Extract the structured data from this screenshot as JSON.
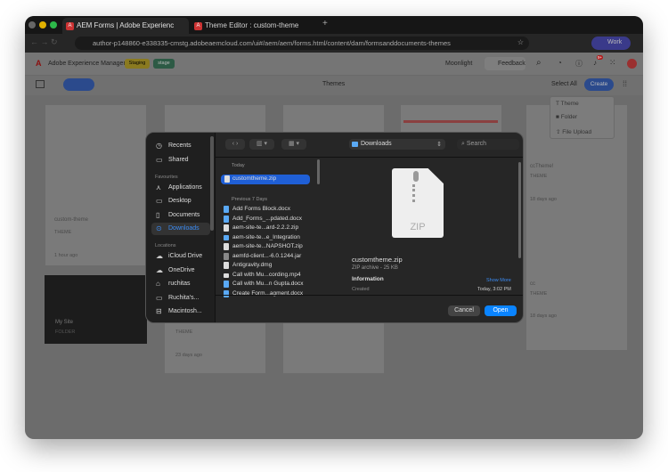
{
  "browser": {
    "tabs": [
      {
        "label": "AEM Forms | Adobe Experienc"
      },
      {
        "label": "Theme Editor : custom-theme"
      }
    ],
    "url": "author-p148860-e338335-cmstg.adobeaemcloud.com/ui#/aem/aem/forms.html/content/dam/formsanddocuments-themes",
    "profile": "Work"
  },
  "aem": {
    "product": "Adobe Experience Manager",
    "badges": [
      "Staging",
      "stage"
    ],
    "org": "Moonlight",
    "feedback": "Feedback",
    "notifications": "9+",
    "page_title": "Themes",
    "select_all": "Select All",
    "create": "Create",
    "create_menu": [
      {
        "label": "Theme",
        "icon": "theme-icon"
      },
      {
        "label": "Folder",
        "icon": "folder-icon"
      },
      {
        "label": "File Upload",
        "icon": "upload-icon"
      }
    ],
    "cards": [
      {
        "title": "custom-theme",
        "type": "THEME",
        "time": "1 hour ago"
      },
      {
        "title": "ccTheme!",
        "type": "THEME",
        "time": "18 days ago"
      },
      {
        "title": "My Site",
        "type": "FOLDER"
      },
      {
        "title": "",
        "type": "THEME",
        "time": "23 days ago"
      },
      {
        "title": "cc",
        "type": "THEME",
        "time": "18 days ago"
      }
    ]
  },
  "dialog": {
    "sidebar": {
      "items": [
        {
          "label": "Recents",
          "icon": "clock-icon"
        },
        {
          "label": "Shared",
          "icon": "shared-folder-icon"
        }
      ],
      "favourites_label": "Favourites",
      "favourites": [
        {
          "label": "Applications",
          "icon": "applications-icon"
        },
        {
          "label": "Desktop",
          "icon": "desktop-icon"
        },
        {
          "label": "Documents",
          "icon": "document-icon"
        },
        {
          "label": "Downloads",
          "icon": "download-icon",
          "selected": true
        }
      ],
      "locations_label": "Locations",
      "locations": [
        {
          "label": "iCloud Drive",
          "icon": "cloud-icon"
        },
        {
          "label": "OneDrive",
          "icon": "onedrive-icon"
        },
        {
          "label": "ruchitas",
          "icon": "home-icon"
        },
        {
          "label": "Ruchita's...",
          "icon": "laptop-icon"
        },
        {
          "label": "Macintosh...",
          "icon": "drive-icon"
        }
      ]
    },
    "location": "Downloads",
    "search_placeholder": "Search",
    "today_label": "Today",
    "today_files": [
      "customtheme.zip"
    ],
    "previous_label": "Previous 7 Days",
    "files": [
      "Add Forms Block.docx",
      "Add_Forms_...pdated.docx",
      "aem-site-te...ard-2.2.2.zip",
      "aem-site-te...e_Integration",
      "aem-site-te...NAPSHOT.zip",
      "aemfd-client...-6.0.1244.jar",
      "Antigravity.dmg",
      "Call with Mu...cording.mp4",
      "Call with Mu...n Gupta.docx",
      "Create Form...agment.docx"
    ],
    "preview": {
      "icon_label": "ZIP",
      "name": "customtheme.zip",
      "kind": "ZIP archive - 25 KB",
      "info_label": "Information",
      "show_more": "Show More",
      "created_label": "Created",
      "created_value": "Today, 3:02 PM"
    },
    "cancel": "Cancel",
    "open": "Open",
    "accent": "#0a84ff"
  }
}
